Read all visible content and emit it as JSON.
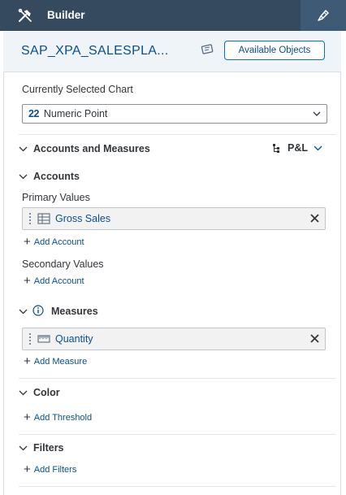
{
  "topbar": {
    "title": "Builder",
    "tools_icon": "tools-icon",
    "designer_icon": "paint-brush-icon"
  },
  "header": {
    "model_name": "SAP_XPA_SALESPLA...",
    "comment_icon": "comment-icon",
    "available_objects_label": "Available Objects"
  },
  "chart": {
    "label": "Currently Selected Chart",
    "selected_icon": "22",
    "selected_value": "Numeric Point"
  },
  "accounts_measures": {
    "title": "Accounts and Measures",
    "hierarchy_label": "P&L"
  },
  "accounts": {
    "title": "Accounts",
    "primary_label": "Primary Values",
    "primary_items": [
      {
        "label": "Gross Sales"
      }
    ],
    "add_account_label": "Add Account",
    "secondary_label": "Secondary Values",
    "add_account_label_2": "Add Account"
  },
  "measures": {
    "title": "Measures",
    "items": [
      {
        "label": "Quantity"
      }
    ],
    "add_label": "Add Measure"
  },
  "color": {
    "title": "Color",
    "add_label": "Add Threshold"
  },
  "filters": {
    "title": "Filters",
    "add_label": "Add Filters"
  },
  "colors": {
    "topbar": "#354a5f",
    "accent": "#0a6ed1",
    "link": "#0a4f8a"
  }
}
